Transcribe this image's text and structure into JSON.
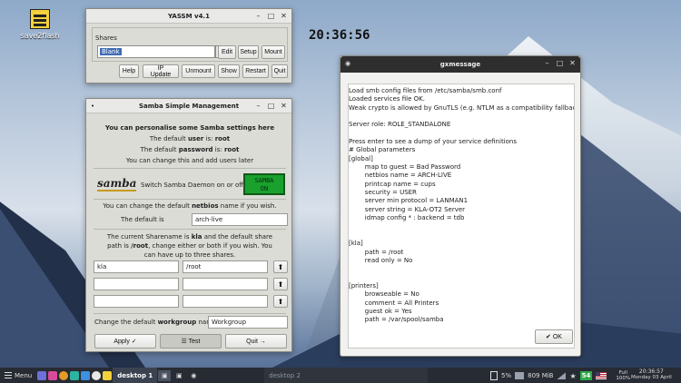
{
  "desktop": {
    "icon_label": "save2flash",
    "clock": "20:36:56"
  },
  "yassm": {
    "title": "YASSM v4.1",
    "shares_label": "Shares",
    "share_value": "Blank",
    "buttons_row1": [
      "Edit",
      "Setup",
      "Mount"
    ],
    "buttons_row2": [
      "Help",
      "IP Update",
      "Unmount",
      "Show",
      "Restart",
      "Quit"
    ]
  },
  "ssm": {
    "title": "Samba Simple Management",
    "intro_heading": "You can personalise some Samba settings here",
    "default_user_prefix": "The default ",
    "default_user_key": "user",
    "default_user_mid": " is: ",
    "default_user_value": "root",
    "default_pass_prefix": "The default ",
    "default_pass_key": "password",
    "default_pass_mid": " is: ",
    "default_pass_value": "root",
    "change_note": "You can change this and add users later",
    "samba_logo": "samba",
    "switch_text": "Switch Samba Daemon on or off.",
    "samba_on_line1": "SAMBA",
    "samba_on_line2": "ON",
    "netbios_prefix": "You can change the default ",
    "netbios_key": "netbios",
    "netbios_suffix": " name if you wish.",
    "default_is_label": "The default is",
    "netbios_value": "arch-live",
    "share_text_1a": "The current Sharename is ",
    "share_text_1b": "kla",
    "share_text_1c": " and the default share",
    "share_text_2a": "path is ",
    "share_text_2b": "/root",
    "share_text_2c": ", change either or both if you wish. You",
    "share_text_3": "can have up to three shares.",
    "shares": [
      {
        "name": "kla",
        "path": "/root"
      },
      {
        "name": "",
        "path": ""
      },
      {
        "name": "",
        "path": ""
      }
    ],
    "workgroup_prefix": "Change the default ",
    "workgroup_key": "workgroup",
    "workgroup_suffix": " name",
    "workgroup_value": "Workgroup",
    "apply_label": "Apply ✓",
    "test_label": "☰ Test",
    "quit_label": "Quit →"
  },
  "gxmessage": {
    "title": "gxmessage",
    "ok_label": "✔ OK",
    "lines": [
      "Load smb config files from /etc/samba/smb.conf",
      "Loaded services file OK.",
      "Weak crypto is allowed by GnuTLS (e.g. NTLM as a compatibility fallback)",
      "",
      "Server role: ROLE_STANDALONE",
      "",
      "Press enter to see a dump of your service definitions",
      "# Global parameters",
      "[global]",
      "        map to guest = Bad Password",
      "        netbios name = ARCH-LIVE",
      "        printcap name = cups",
      "        security = USER",
      "        server min protocol = LANMAN1",
      "        server string = KLA-OT2 Server",
      "        idmap config * : backend = tdb",
      "",
      "",
      "[kla]",
      "        path = /root",
      "        read only = No",
      "",
      "",
      "[printers]",
      "        browseable = No",
      "        comment = All Printers",
      "        guest ok = Yes",
      "        path = /var/spool/samba"
    ]
  },
  "taskbar": {
    "menu_label": "Menu",
    "desktop_active": "desktop 1",
    "desktop_inactive": "desktop 2",
    "battery": "5%",
    "memory": "809 MiB",
    "badge": "54",
    "power_top": "Full",
    "power_bottom": "100%",
    "time": "20:36:57",
    "date": "Monday 03 April"
  }
}
